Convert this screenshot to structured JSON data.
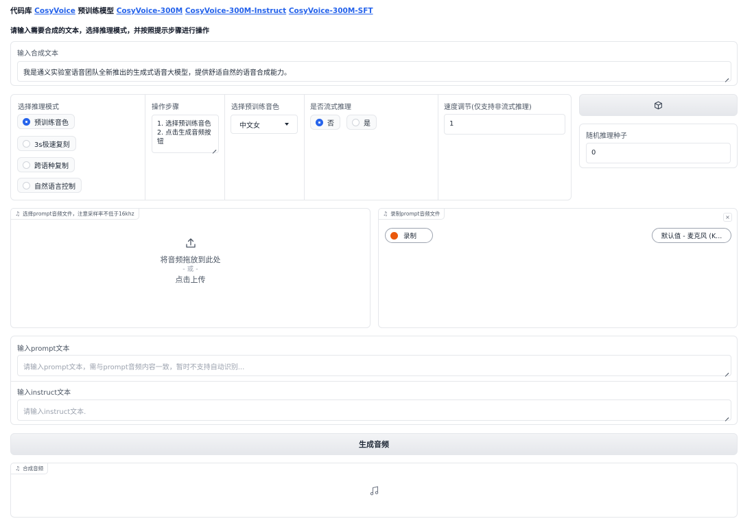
{
  "header": {
    "repo_label": "代码库",
    "repo_link": "CosyVoice",
    "models_label": "预训练模型",
    "model_links": [
      "CosyVoice-300M",
      "CosyVoice-300M-Instruct",
      "CosyVoice-300M-SFT"
    ]
  },
  "instruction": "请输入需要合成的文本，选择推理模式，并按照提示步骤进行操作",
  "tts_text": {
    "label": "输入合成文本",
    "value": "我是通义实验室语音团队全新推出的生成式语音大模型，提供舒适自然的语音合成能力。"
  },
  "mode": {
    "label": "选择推理模式",
    "options": [
      "预训练音色",
      "3s极速复刻",
      "跨语种复制",
      "自然语言控制"
    ],
    "selected": "预训练音色"
  },
  "steps": {
    "label": "操作步骤",
    "lines": [
      "1. 选择预训练音色",
      "2. 点击生成音频按",
      "钮"
    ]
  },
  "speaker": {
    "label": "选择预训练音色",
    "value": "中文女"
  },
  "stream": {
    "label": "是否流式推理",
    "options": [
      "否",
      "是"
    ],
    "selected": "否"
  },
  "speed": {
    "label": "速度调节(仅支持非流式推理)",
    "value": "1"
  },
  "seed": {
    "label": "随机推理种子",
    "value": "0"
  },
  "prompt_upload": {
    "tag": "选择prompt音频文件，注意采样率不低于16khz",
    "drop_text": "将音频拖放到此处",
    "or_text": "- 或 -",
    "click_text": "点击上传"
  },
  "prompt_record": {
    "tag": "录制prompt音频文件",
    "record_label": "录制",
    "mic_label": "默认值 - 麦克风 (K..."
  },
  "prompt_text": {
    "label": "输入prompt文本",
    "placeholder": "请输入prompt文本，需与prompt音频内容一致，暂时不支持自动识别..."
  },
  "instruct_text": {
    "label": "输入instruct文本",
    "placeholder": "请输入instruct文本."
  },
  "generate_label": "生成音频",
  "output": {
    "tag": "合成音频"
  },
  "colors": {
    "link": "#2563eb",
    "radio_selected": "#2563eb",
    "record_dot": "#ea580c"
  },
  "icons": {
    "dice": "dice-icon",
    "upload": "upload-icon",
    "music": "music-note-icon",
    "close": "close-icon"
  }
}
